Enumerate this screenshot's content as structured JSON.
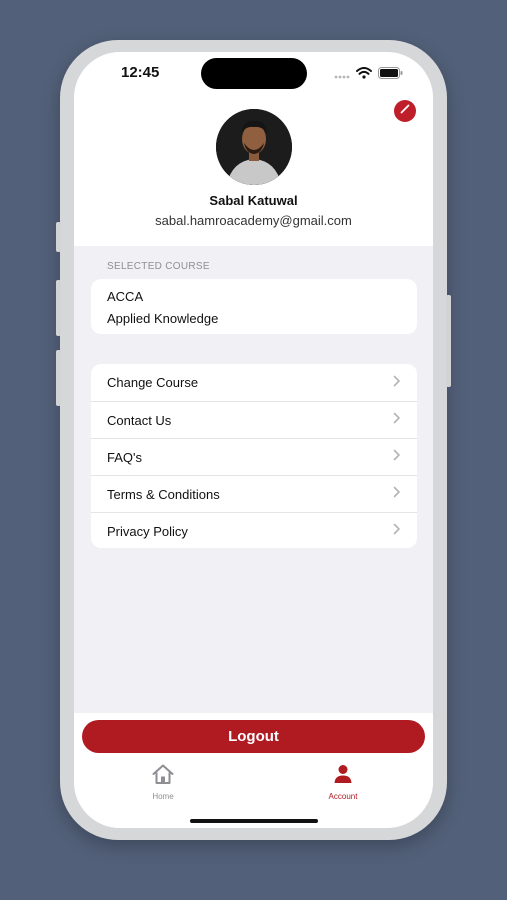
{
  "status_bar": {
    "time": "12:45"
  },
  "profile": {
    "name": "Sabal Katuwal",
    "email": "sabal.hamroacademy@gmail.com"
  },
  "selected_course": {
    "section_label": "SELECTED COURSE",
    "course": "ACCA",
    "subject": "Applied Knowledge"
  },
  "menu": {
    "items": [
      {
        "label": "Change Course"
      },
      {
        "label": "Contact Us"
      },
      {
        "label": "FAQ's"
      },
      {
        "label": "Terms & Conditions"
      },
      {
        "label": "Privacy Policy"
      }
    ]
  },
  "logout_label": "Logout",
  "tab_bar": {
    "home_label": "Home",
    "account_label": "Account"
  },
  "colors": {
    "accent": "#b01b22",
    "background": "#526079",
    "inactive_tab": "#8e8e93"
  },
  "icons": [
    "pencil-icon",
    "wifi-icon",
    "battery-icon",
    "chevron-right-icon",
    "home-icon",
    "person-icon"
  ]
}
